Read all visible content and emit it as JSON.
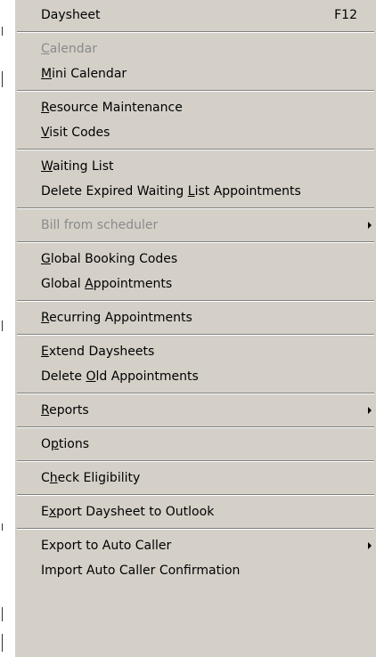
{
  "menu": {
    "groups": [
      [
        {
          "pre": "Daysheet",
          "acc": "",
          "post": "",
          "shortcut": "F12",
          "disabled": false,
          "submenu": false
        }
      ],
      [
        {
          "pre": "",
          "acc": "C",
          "post": "alendar",
          "disabled": true,
          "submenu": false
        },
        {
          "pre": "",
          "acc": "M",
          "post": "ini Calendar",
          "disabled": false,
          "submenu": false
        }
      ],
      [
        {
          "pre": "",
          "acc": "R",
          "post": "esource Maintenance",
          "disabled": false,
          "submenu": false
        },
        {
          "pre": "",
          "acc": "V",
          "post": "isit Codes",
          "disabled": false,
          "submenu": false
        }
      ],
      [
        {
          "pre": "",
          "acc": "W",
          "post": "aiting List",
          "disabled": false,
          "submenu": false
        },
        {
          "pre": "Delete Expired Waiting ",
          "acc": "L",
          "post": "ist Appointments",
          "disabled": false,
          "submenu": false
        }
      ],
      [
        {
          "pre": "Bill from scheduler",
          "acc": "",
          "post": "",
          "disabled": true,
          "submenu": true
        }
      ],
      [
        {
          "pre": "",
          "acc": "G",
          "post": "lobal Booking Codes",
          "disabled": false,
          "submenu": false
        },
        {
          "pre": "Global ",
          "acc": "A",
          "post": "ppointments",
          "disabled": false,
          "submenu": false
        }
      ],
      [
        {
          "pre": "",
          "acc": "R",
          "post": "ecurring Appointments",
          "disabled": false,
          "submenu": false
        }
      ],
      [
        {
          "pre": "",
          "acc": "E",
          "post": "xtend Daysheets",
          "disabled": false,
          "submenu": false
        },
        {
          "pre": "Delete ",
          "acc": "O",
          "post": "ld Appointments",
          "disabled": false,
          "submenu": false
        }
      ],
      [
        {
          "pre": "",
          "acc": "R",
          "post": "eports",
          "disabled": false,
          "submenu": true
        }
      ],
      [
        {
          "pre": "O",
          "acc": "p",
          "post": "tions",
          "disabled": false,
          "submenu": false
        }
      ],
      [
        {
          "pre": "C",
          "acc": "h",
          "post": "eck Eligibility",
          "disabled": false,
          "submenu": false
        }
      ],
      [
        {
          "pre": "E",
          "acc": "x",
          "post": "port Daysheet to Outlook",
          "disabled": false,
          "submenu": false
        }
      ],
      [
        {
          "pre": "Export to Auto Caller",
          "acc": "",
          "post": "",
          "disabled": false,
          "submenu": true
        },
        {
          "pre": "Import Auto Caller Confirmation",
          "acc": "",
          "post": "",
          "disabled": false,
          "submenu": false
        }
      ]
    ]
  }
}
